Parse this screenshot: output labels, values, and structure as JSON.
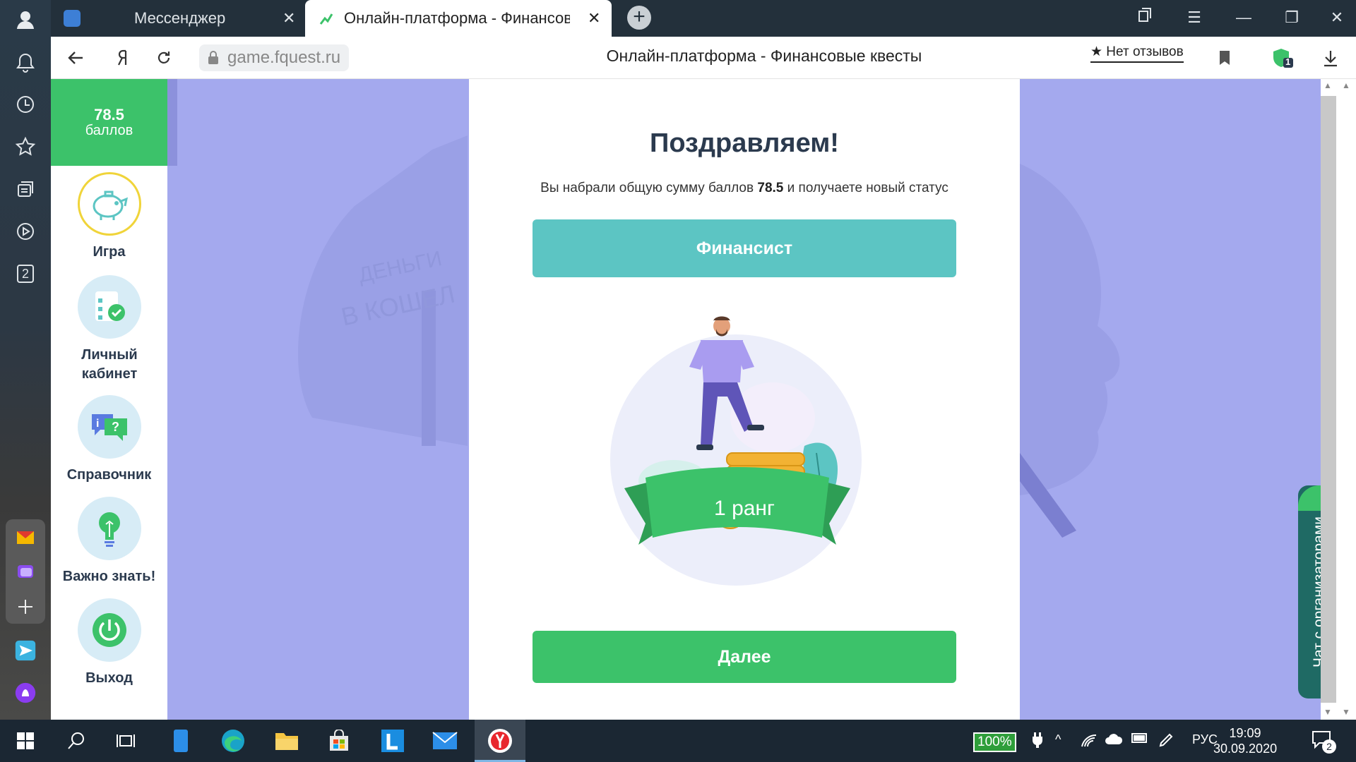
{
  "browser": {
    "tabs": [
      {
        "title": "Мессенджер",
        "close": "✕"
      },
      {
        "title": "Онлайн-платформа - Финансовые квесты",
        "close": "✕"
      }
    ],
    "new_tab": "+",
    "url": "game.fquest.ru",
    "page_title": "Онлайн-платформа - Финансовые квесты",
    "reviews": "★ Нет отзывов",
    "protect_badge": "1"
  },
  "left_panel": {
    "tab_count_badge": "2"
  },
  "sidebar": {
    "score_value": "78.5",
    "score_unit": "баллов",
    "items": [
      {
        "label": "Игра",
        "icon": "piggy-bank-icon"
      },
      {
        "label": "Личный кабинет",
        "icon": "checklist-icon"
      },
      {
        "label": "Справочник",
        "icon": "info-chat-icon"
      },
      {
        "label": "Важно знать!",
        "icon": "lightbulb-icon"
      },
      {
        "label": "Выход",
        "icon": "power-icon"
      }
    ]
  },
  "modal": {
    "title": "Поздравляем!",
    "text_before": "Вы набрали общую сумму баллов",
    "text_score": "78.5",
    "text_after": "и получаете новый статус",
    "status": "Финансист",
    "rank": "1 ранг",
    "next_button": "Далее"
  },
  "background_words": {
    "line1": "ДЕНЬГИ",
    "line2": "В КОШЕЛ"
  },
  "chat": {
    "label": "Чат с организаторами"
  },
  "taskbar": {
    "battery": "100%",
    "language": "РУС",
    "time": "19:09",
    "date": "30.09.2020",
    "notifications": "2"
  },
  "colors": {
    "accent_green": "#3cc26a",
    "teal": "#5cc5c3",
    "page_bg": "#a4a9ee",
    "sidebar_circle": "#d7ecf6",
    "title_text": "#2b3a4e"
  }
}
